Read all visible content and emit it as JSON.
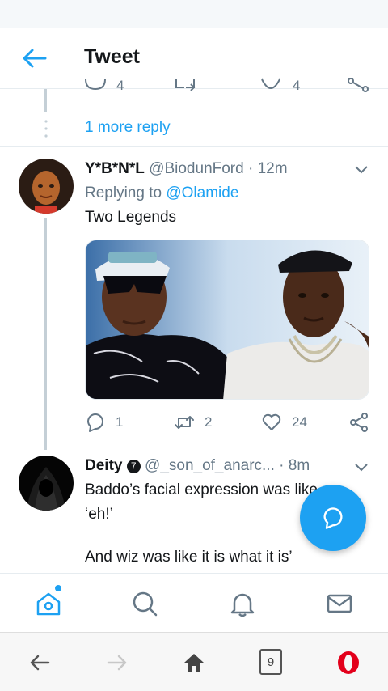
{
  "colors": {
    "accent": "#1da1f2",
    "text": "#14171a",
    "muted": "#657786",
    "opera_red": "#e3001b"
  },
  "header": {
    "title": "Tweet"
  },
  "prev_tweet_actions": {
    "reply_count": "4",
    "like_count": "4"
  },
  "thread": {
    "more_reply": "1 more reply"
  },
  "tweets": [
    {
      "name": "Y*B*N*L",
      "handle": "@BiodunFord",
      "separator": "·",
      "time": "12m",
      "replying_prefix": "Replying to",
      "replying_to": "@Olamide",
      "text": "Two Legends",
      "reply_count": "1",
      "retweet_count": "2",
      "like_count": "24"
    },
    {
      "name": "Deity",
      "verified_badge": "7",
      "handle": "@_son_of_anarc...",
      "separator": "·",
      "time": "8m",
      "text_line1": "Baddo’s facial expression was like",
      "text_line2": "‘eh!’",
      "text_line3": "And wiz was like it is what it is’"
    }
  ],
  "bottom_nav": [
    "home-icon",
    "search-icon",
    "notifications-icon",
    "messages-icon"
  ],
  "browser_bar": {
    "tab_count": "9"
  }
}
